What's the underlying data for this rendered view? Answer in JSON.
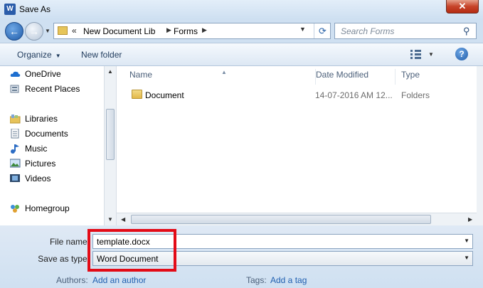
{
  "window": {
    "title": "Save As",
    "app_icon": "word-icon",
    "close_symbol": "✕"
  },
  "nav": {
    "path_chevron": "«",
    "path": [
      "New Document Lib",
      "Forms"
    ],
    "search_placeholder": "Search Forms"
  },
  "toolbar": {
    "organize": "Organize",
    "new_folder": "New folder",
    "help": "?"
  },
  "sidebar": {
    "items": [
      {
        "label": "OneDrive",
        "icon": "cloud-icon"
      },
      {
        "label": "Recent Places",
        "icon": "recent-places-icon"
      },
      {
        "label": "Libraries",
        "icon": "libraries-icon"
      },
      {
        "label": "Documents",
        "icon": "documents-icon"
      },
      {
        "label": "Music",
        "icon": "music-icon"
      },
      {
        "label": "Pictures",
        "icon": "pictures-icon"
      },
      {
        "label": "Videos",
        "icon": "videos-icon"
      },
      {
        "label": "Homegroup",
        "icon": "homegroup-icon"
      }
    ]
  },
  "files": {
    "columns": [
      "Name",
      "Date Modified",
      "Type"
    ],
    "rows": [
      {
        "name": "Document",
        "date": "14-07-2016 AM 12...",
        "type": "Folders"
      }
    ]
  },
  "form": {
    "file_name_label": "File name:",
    "file_name_value": "template.docx",
    "save_type_label": "Save as type:",
    "save_type_value": "Word Document",
    "authors_label": "Authors:",
    "authors_link": "Add an author",
    "tags_label": "Tags:",
    "tags_link": "Add a tag"
  },
  "colors": {
    "highlight": "#e30b17",
    "link": "#1f5fb0",
    "accent": "#2a5caa"
  }
}
